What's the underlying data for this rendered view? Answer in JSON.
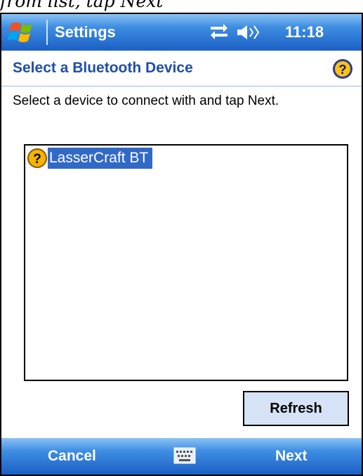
{
  "caption": "from list, tap Next",
  "titlebar": {
    "app_title": "Settings",
    "clock": "11:18",
    "icons": [
      "windows-flag-icon",
      "connectivity-icon",
      "volume-icon"
    ]
  },
  "header": {
    "title": "Select a Bluetooth Device",
    "help_icon": "help-icon"
  },
  "instructions": "Select a device to connect with and tap Next.",
  "device_list": {
    "items": [
      {
        "label": "LasserCraft BT",
        "icon": "unknown-device-icon",
        "selected": true
      }
    ]
  },
  "buttons": {
    "refresh": "Refresh"
  },
  "menubar": {
    "left_softkey": "Cancel",
    "right_softkey": "Next",
    "center_icon": "keyboard-icon"
  },
  "colors": {
    "bar_blue": "#1b5fc4",
    "title_blue": "#1f4ea8",
    "selection": "#3169c6",
    "button_bg": "#d6e2f5"
  }
}
